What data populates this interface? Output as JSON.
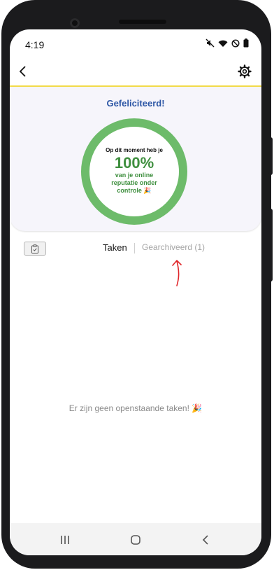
{
  "status_bar": {
    "time": "4:19",
    "icons": [
      "mute-icon",
      "wifi-icon",
      "do-not-disturb-icon",
      "battery-icon"
    ]
  },
  "app_bar": {
    "back_icon": "chevron-left-icon",
    "settings_icon": "gear-icon",
    "accent_line_color": "#f3dc4a"
  },
  "reputation_card": {
    "title": "Gefeliciteerd!",
    "line1": "Op dit moment heb je",
    "percent": "100%",
    "line2": "van je online reputatie onder controle 🎉",
    "progress": 1.0,
    "ring_color": "#6dbb6a",
    "title_color": "#2c56a5"
  },
  "tabs": {
    "icon": "clipboard-icon",
    "active": "Taken",
    "archived": "Gearchiveerd (1)"
  },
  "empty_message": "Er zijn geen openstaande taken! 🎉",
  "nav_bar": {
    "items": [
      "recents-icon",
      "home-icon",
      "back-icon"
    ]
  }
}
